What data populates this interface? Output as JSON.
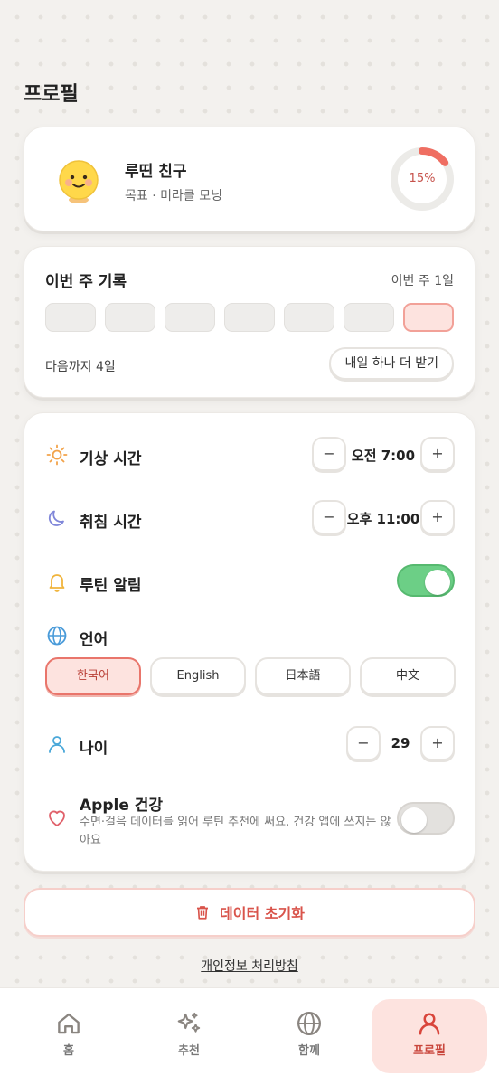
{
  "page": {
    "title": "프로필"
  },
  "profile": {
    "name": "루띤 친구",
    "goal": "목표 · 미라클 모닝",
    "progress_percent": 15,
    "progress_label": "15%"
  },
  "week": {
    "title": "이번 주 기록",
    "count_label": "이번 주 1일",
    "days_recorded": [
      false,
      false,
      false,
      false,
      false,
      false,
      true
    ],
    "next_label": "다음까지 4일",
    "more_button": "내일 하나 더 받기"
  },
  "settings": {
    "wake": {
      "label": "기상 시간",
      "value": "오전 7:00",
      "minus": "−",
      "plus": "+"
    },
    "sleep": {
      "label": "취침 시간",
      "value": "오후 11:00",
      "minus": "−",
      "plus": "+"
    },
    "alarm": {
      "label": "루틴 알림",
      "enabled": true
    },
    "language": {
      "label": "언어",
      "options": [
        "한국어",
        "English",
        "日本語",
        "中文"
      ],
      "selected": "한국어"
    },
    "age": {
      "label": "나이",
      "value": "29",
      "minus": "−",
      "plus": "+"
    },
    "health": {
      "label": "Apple 건강",
      "description": "수면·걸음 데이터를 읽어 루틴 추천에 써요. 건강 앱에 쓰지는 않아요",
      "enabled": false
    }
  },
  "reset_button": "데이터 초기화",
  "privacy_link": "개인정보 처리방침",
  "nav": {
    "items": [
      {
        "label": "홈",
        "icon": "home-icon"
      },
      {
        "label": "추천",
        "icon": "sparkles-icon"
      },
      {
        "label": "함께",
        "icon": "globe-icon"
      },
      {
        "label": "프로필",
        "icon": "user-icon"
      }
    ],
    "active": "프로필"
  },
  "colors": {
    "accent": "#e9756b",
    "toggle_on": "#6ccf86",
    "toggle_off": "#e3e1de",
    "reset": "#d9544b"
  }
}
